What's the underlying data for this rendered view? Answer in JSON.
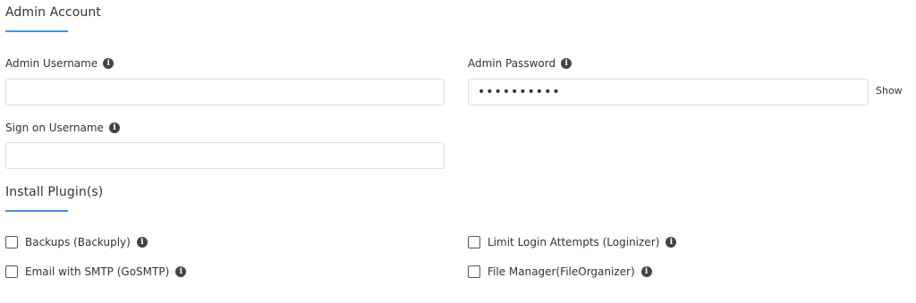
{
  "admin_account": {
    "title": "Admin Account",
    "username_label": "Admin Username",
    "username_value": "",
    "password_label": "Admin Password",
    "password_value": "••••••••••",
    "show_label": "Show",
    "sign_on_label": "Sign on Username",
    "sign_on_value": ""
  },
  "plugins": {
    "title": "Install Plugin(s)",
    "items": [
      {
        "label": "Backups (Backuply)",
        "checked": false
      },
      {
        "label": "Limit Login Attempts (Loginizer)",
        "checked": false
      },
      {
        "label": "Email with SMTP (GoSMTP)",
        "checked": false
      },
      {
        "label": "File Manager(FileOrganizer)",
        "checked": false
      }
    ]
  },
  "icons": {
    "info": "info-icon",
    "info_glyph": "i"
  },
  "colors": {
    "accent": "#4a90e2",
    "border": "#dcdcdc",
    "icon": "#444444"
  }
}
